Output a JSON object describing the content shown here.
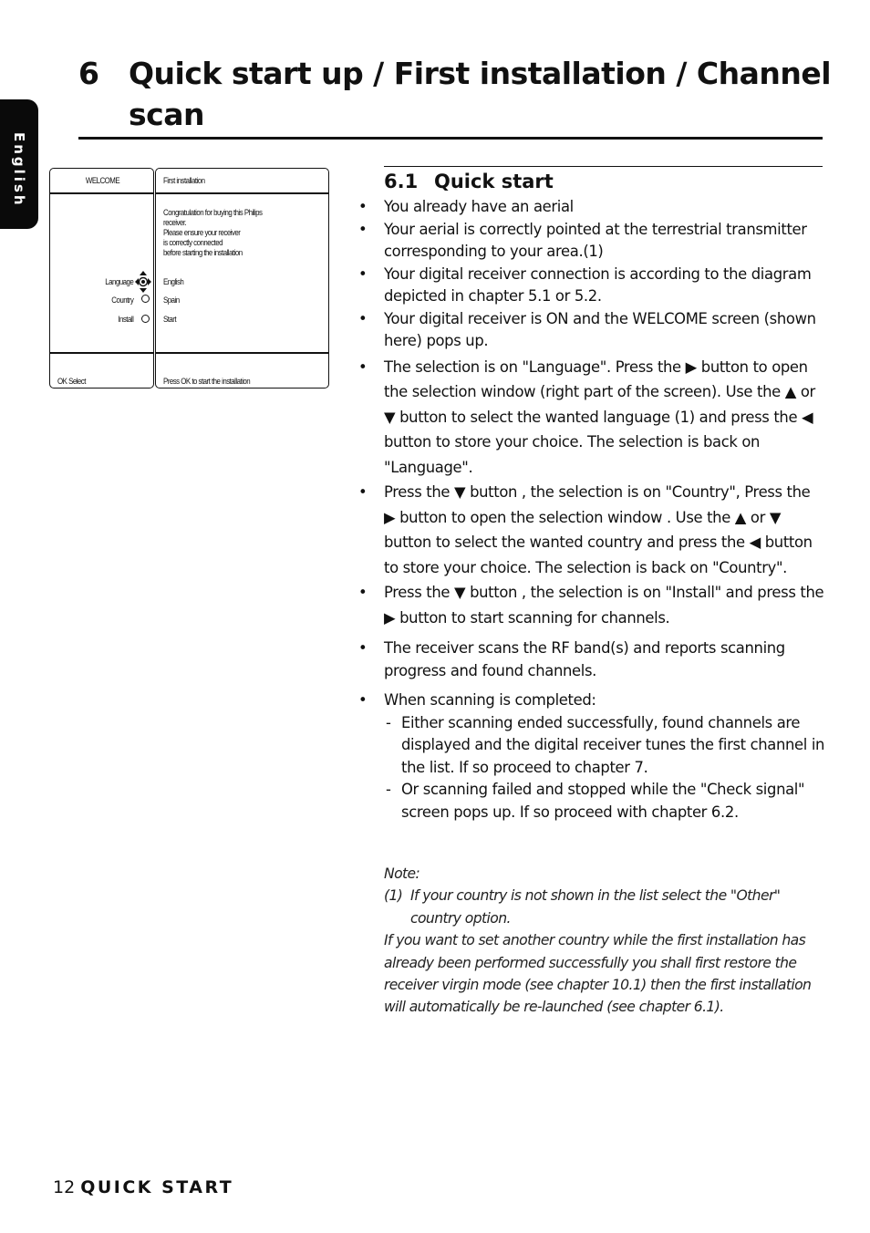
{
  "side_tab": {
    "label": "English"
  },
  "chapter": {
    "number": "6",
    "title": "Quick start up / First installation / Channel scan"
  },
  "screen": {
    "left_header": "WELCOME",
    "right_header": "First installation",
    "message_lines": [
      "Congratulation for buying this Philips",
      "receiver.",
      "Please ensure your receiver",
      "is correctly connected",
      "before starting the installation"
    ],
    "menu": [
      {
        "label": "Language",
        "value": "English",
        "indicator": "nav-pad"
      },
      {
        "label": "Country",
        "value": "Spain",
        "indicator": "radio"
      },
      {
        "label": "Install",
        "value": "Start",
        "indicator": "radio"
      }
    ],
    "footer_left_key": "OK",
    "footer_left_label": "Select",
    "footer_right": "Press OK to start the installation"
  },
  "section": {
    "number": "6.1",
    "title": "Quick start",
    "bullets": [
      "You already have an aerial",
      "Your aerial is correctly pointed at the terrestrial transmitter corresponding to your area.(1)",
      "Your digital receiver connection is according to the diagram depicted in chapter 5.1 or 5.2.",
      "Your digital receiver is ON and the WELCOME screen (shown here) pops up.",
      "The selection is on \"Language\".  Press the ▶ button to open the selection window (right part of the screen). Use the ▲ or ▼ button to select the wanted language (1) and press  the ◀ button to store your choice. The selection is back on \"Language\".",
      "Press the ▼ button , the selection is on \"Country\", Press the ▶ button to  open the selection window . Use the ▲ or ▼ button to select the wanted country and press the ◀ button to store your choice. The selection is back on \"Country\".",
      "Press the ▼ button , the selection is on \"Install\" and press the ▶ button to  start scanning for channels.",
      "The receiver scans the RF band(s) and reports scanning progress and found channels.",
      "When scanning is completed:"
    ],
    "sub_items": [
      "Either scanning ended successfully, found channels are displayed and the digital receiver tunes the first channel in the list. If so proceed to chapter 7.",
      "Or scanning failed and stopped while the \"Check signal\" screen pops up. If so proceed with chapter 6.2."
    ]
  },
  "note": {
    "heading": "Note:",
    "footnote_label": "(1)",
    "footnote_text": "If your country is not shown in the list select the \"Other\" country option.",
    "paragraph": "If you want to set another country while the first installation has already been performed successfully you shall first restore the receiver virgin mode (see chapter 10.1) then the first installation will automatically be re-launched (see chapter 6.1)."
  },
  "footer": {
    "page_number": "12",
    "section_name": "QUICK START"
  }
}
